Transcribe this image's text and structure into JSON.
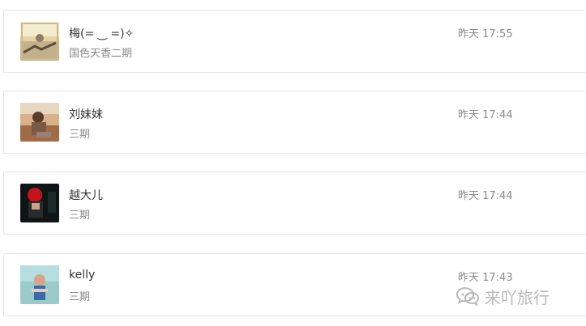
{
  "list": {
    "items": [
      {
        "name": "梅(= ‿ =)✧",
        "subtitle": "国色天香二期",
        "time": "昨天 17:55",
        "avatar_icon": "avatar-photo-icon"
      },
      {
        "name": "刘妹妹",
        "subtitle": "三期",
        "time": "昨天 17:44",
        "avatar_icon": "avatar-photo-icon"
      },
      {
        "name": "越大儿",
        "subtitle": "三期",
        "time": "昨天 17:44",
        "avatar_icon": "avatar-photo-icon"
      },
      {
        "name": "kelly",
        "subtitle": "三期",
        "time": "昨天 17:43",
        "avatar_icon": "avatar-photo-icon"
      }
    ]
  },
  "watermark": {
    "text": "来吖旅行",
    "icon": "wechat-icon"
  },
  "colors": {
    "border": "#e6e6e6",
    "name_text": "#333333",
    "meta_text": "#8a8a8a",
    "watermark_text": "#b9b9b9"
  }
}
